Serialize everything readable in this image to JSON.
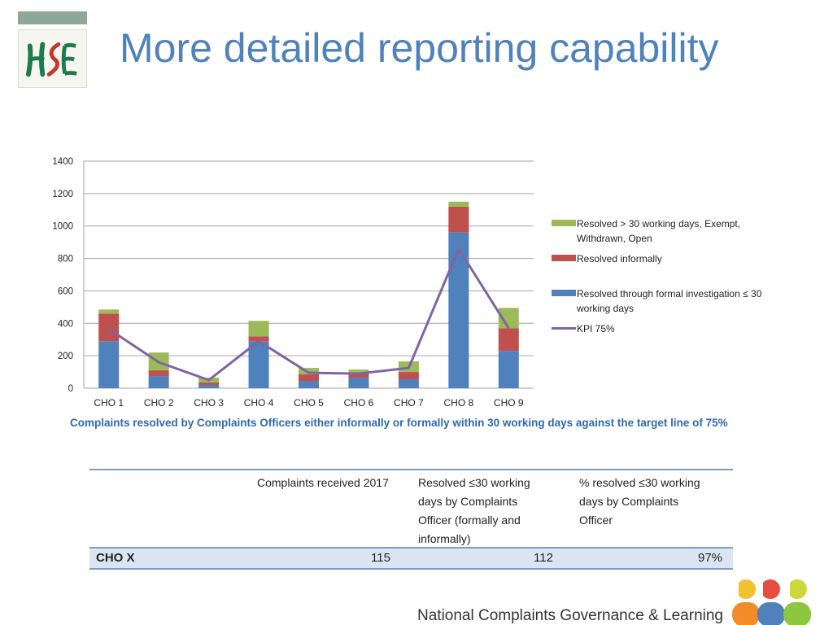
{
  "slide": {
    "title": "More detailed reporting capability",
    "caption": "Complaints resolved by Complaints Officers either informally or formally within 30 working days against the target line of 75%",
    "footer": "National Complaints Governance & Learning"
  },
  "logo": {
    "text": "HSE",
    "colors": {
      "green": "#1f7a4d",
      "red": "#c0392b"
    }
  },
  "chart_data": {
    "type": "bar",
    "stacked": true,
    "categories": [
      "CHO 1",
      "CHO 2",
      "CHO 3",
      "CHO 4",
      "CHO 5",
      "CHO 6",
      "CHO 7",
      "CHO 8",
      "CHO 9"
    ],
    "series": [
      {
        "name": "Resolved through formal investigation ≤ 30 working days",
        "type": "bar",
        "color": "#4f81bd",
        "values": [
          290,
          75,
          20,
          290,
          45,
          65,
          55,
          960,
          230
        ]
      },
      {
        "name": "Resolved informally",
        "type": "bar",
        "color": "#c0504d",
        "values": [
          170,
          35,
          15,
          30,
          40,
          30,
          45,
          160,
          140
        ]
      },
      {
        "name": "Resolved > 30 working days, Exempt, Withdrawn, Open",
        "type": "bar",
        "color": "#9bbb59",
        "values": [
          25,
          110,
          30,
          95,
          40,
          20,
          65,
          30,
          125
        ]
      },
      {
        "name": "KPI 75%",
        "type": "line",
        "color": "#8064a2",
        "values": [
          365,
          160,
          50,
          290,
          95,
          90,
          125,
          860,
          370
        ]
      }
    ],
    "ylim": [
      0,
      1400
    ],
    "yticks": [
      0,
      200,
      400,
      600,
      800,
      1000,
      1200,
      1400
    ],
    "grid": true,
    "legend_position": "right",
    "legend_order": [
      2,
      1,
      0,
      3
    ]
  },
  "table": {
    "headers": [
      "Complaints received 2017",
      "Resolved ≤30 working days by Complaints Officer (formally and informally)",
      "% resolved ≤30 working days by Complaints Officer"
    ],
    "header_lines": [
      [
        "Complaints received 2017"
      ],
      [
        "Resolved ≤30 working",
        "days by Complaints",
        "Officer (formally and",
        "informally)"
      ],
      [
        "% resolved ≤30 working",
        "days by Complaints",
        "Officer"
      ]
    ],
    "row": {
      "label": "CHO X",
      "received": "115",
      "resolved": "112",
      "percent": "97%"
    }
  },
  "dots_colors": [
    "#f2c12e",
    "#f28c28",
    "#4f81bd",
    "#8dc63f",
    "#e84c3d",
    "#c9d93a"
  ]
}
